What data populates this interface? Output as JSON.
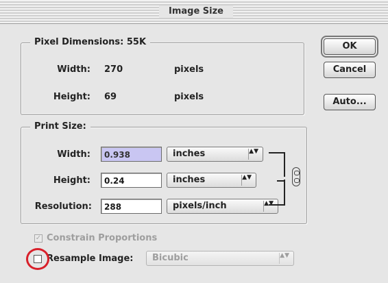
{
  "window": {
    "title": "Image Size"
  },
  "pixel_dimensions": {
    "legend": "Pixel Dimensions: 55K",
    "width": {
      "label": "Width:",
      "value": "270",
      "unit": "pixels"
    },
    "height": {
      "label": "Height:",
      "value": "69",
      "unit": "pixels"
    }
  },
  "print_size": {
    "legend": "Print Size:",
    "width": {
      "label": "Width:",
      "value": "0.938",
      "unit": "inches"
    },
    "height": {
      "label": "Height:",
      "value": "0.24",
      "unit": "inches"
    },
    "resolution": {
      "label": "Resolution:",
      "value": "288",
      "unit": "pixels/inch"
    }
  },
  "constrain": {
    "label": "Constrain Proportions",
    "checked": true,
    "enabled": false
  },
  "resample": {
    "label": "Resample Image:",
    "checked": false,
    "method": "Bicubic",
    "method_enabled": false
  },
  "buttons": {
    "ok": "OK",
    "cancel": "Cancel",
    "auto": "Auto..."
  },
  "popup_arrows": "▲▼",
  "checkmark": "✓",
  "colors": {
    "selection": "#c9c6f2",
    "highlight_circle": "#d8202a"
  }
}
